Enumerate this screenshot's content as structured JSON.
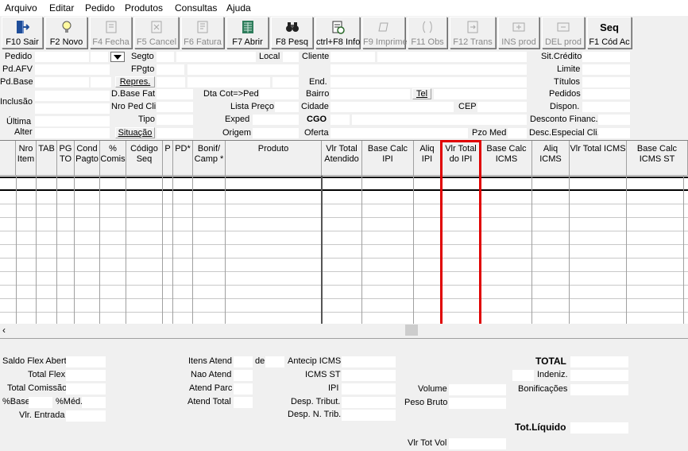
{
  "menu": {
    "arquivo": "Arquivo",
    "editar": "Editar",
    "pedido": "Pedido",
    "produtos": "Produtos",
    "consultas": "Consultas",
    "ajuda": "Ajuda"
  },
  "toolbar": {
    "sair": "F10 Sair",
    "novo": "F2 Novo",
    "fecha": "F4 Fecha",
    "cancel": "F5 Cancel",
    "fatura": "F6 Fatura",
    "abrir": "F7 Abrir",
    "pesq": "F8 Pesq",
    "info": "ctrl+F8 Info",
    "imprime": "F9 Imprime",
    "obs": "F11 Obs",
    "trans": "F12 Trans",
    "ins_prod": "INS prod",
    "del_prod": "DEL prod",
    "seq_title": "Seq",
    "seq_label": "F1 Cód Ac"
  },
  "header": {
    "pedido": "Pedido",
    "pd_afv": "Pd.AFV",
    "pd_base": "Pd.Base",
    "inclusao": "Inclusão",
    "ultima": "Última",
    "alter": "Alter",
    "segto": "Segto",
    "fpgto": "FPgto",
    "repres": "Repres.",
    "d_base_fat": "D.Base Fat",
    "nro_ped_cli": "Nro Ped Cli",
    "tipo": "Tipo",
    "situacao": "Situação",
    "local": "Local",
    "dta_cot_ped": "Dta Cot=>Ped",
    "lista_preco": "Lista Preço",
    "exped": "Exped",
    "origem": "Origem",
    "cliente": "Cliente",
    "end": "End.",
    "bairro": "Bairro",
    "cidade": "Cidade",
    "cgo": "CGO",
    "oferta": "Oferta",
    "tel": "Tel",
    "cep": "CEP",
    "pzo_med": "Pzo Med",
    "sit_credito": "Sit.Crédito",
    "limite": "Limite",
    "titulos": "Títulos",
    "pedidos": "Pedidos",
    "dispon": "Dispon.",
    "desconto_financ": "Desconto Financ.",
    "desc_especial": "Desc.Especial Cli."
  },
  "grid": {
    "columns": [
      "Nro Item",
      "TAB",
      "PG TO",
      "Cond Pagto",
      "% Comis",
      "Código Seq",
      "P",
      "PD*",
      "Bonif/ Camp *",
      "Produto",
      "Vlr Total Atendido",
      "Base Calc IPI",
      "Aliq IPI",
      "Vlr Total do IPI",
      "Base Calc ICMS",
      "Aliq ICMS",
      "Vlr Total ICMS",
      "Base Calc ICMS ST"
    ],
    "highlight_color": "#e00000"
  },
  "footer": {
    "saldo_flex_abert": "Saldo Flex Abert",
    "total_flex": "Total Flex",
    "total_comissao": "Total Comissão",
    "pct_base": "%Base",
    "pct_med": "%Méd.",
    "vlr_entrada": "Vlr. Entrada",
    "itens_atend": "Itens Atend",
    "de": "de",
    "nao_atend": "Nao Atend",
    "atend_parc": "Atend Parc",
    "atend_total": "Atend Total",
    "antecip_icms": "Antecip ICMS",
    "icms_st": "ICMS ST",
    "ipi": "IPI",
    "desp_tribut": "Desp. Tribut.",
    "desp_n_trib": "Desp. N. Trib.",
    "volume": "Volume",
    "peso_bruto": "Peso Bruto",
    "vlr_tot_vol": "Vlr Tot Vol",
    "total": "TOTAL",
    "indeniz": "Indeniz.",
    "bonificacoes": "Bonificações",
    "tot_liquido": "Tot.Líquido"
  }
}
